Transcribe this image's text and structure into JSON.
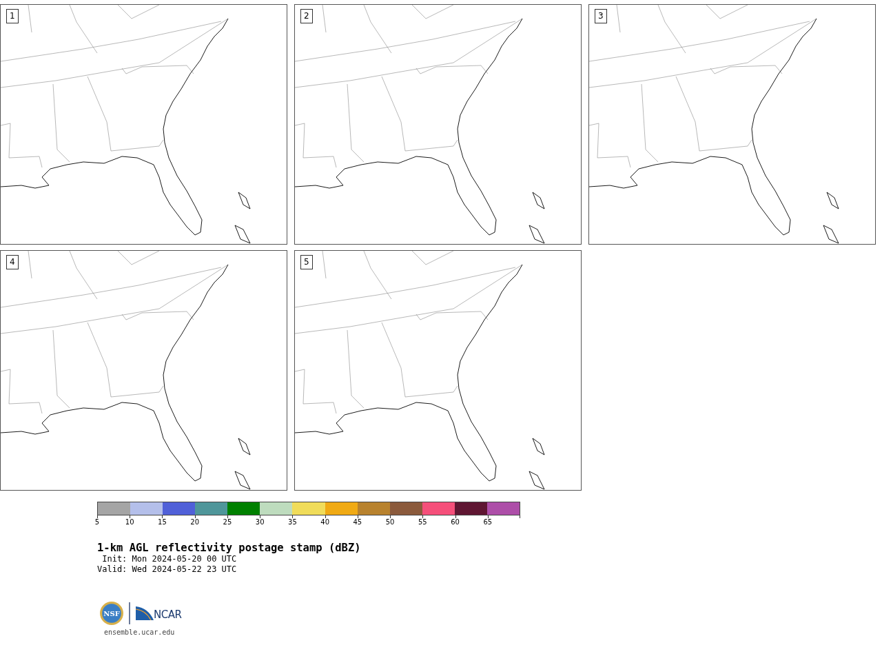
{
  "panels": [
    {
      "label": "1"
    },
    {
      "label": "2"
    },
    {
      "label": "3"
    },
    {
      "label": "4"
    },
    {
      "label": "5"
    }
  ],
  "colorbar": {
    "segments": [
      {
        "color": "#a5a5a5",
        "tick": "5"
      },
      {
        "color": "#b4bfea",
        "tick": "10"
      },
      {
        "color": "#5060d8",
        "tick": "15"
      },
      {
        "color": "#4f969a",
        "tick": "20"
      },
      {
        "color": "#008000",
        "tick": "25"
      },
      {
        "color": "#bedcbe",
        "tick": "30"
      },
      {
        "color": "#f0dc5a",
        "tick": "35"
      },
      {
        "color": "#f0aa14",
        "tick": "40"
      },
      {
        "color": "#b8822e",
        "tick": "45"
      },
      {
        "color": "#8b5a3c",
        "tick": "50"
      },
      {
        "color": "#f54f7a",
        "tick": "55"
      },
      {
        "color": "#5f1632",
        "tick": "60"
      },
      {
        "color": "#ad4ea8",
        "tick": "65"
      }
    ]
  },
  "title": "1-km AGL reflectivity postage stamp (dBZ)",
  "init": " Init: Mon 2024-05-20 00 UTC",
  "valid": "Valid: Wed 2024-05-22 23 UTC",
  "logos": {
    "nsf": "NSF",
    "ncar": "NCAR"
  },
  "url": "ensemble.ucar.edu"
}
